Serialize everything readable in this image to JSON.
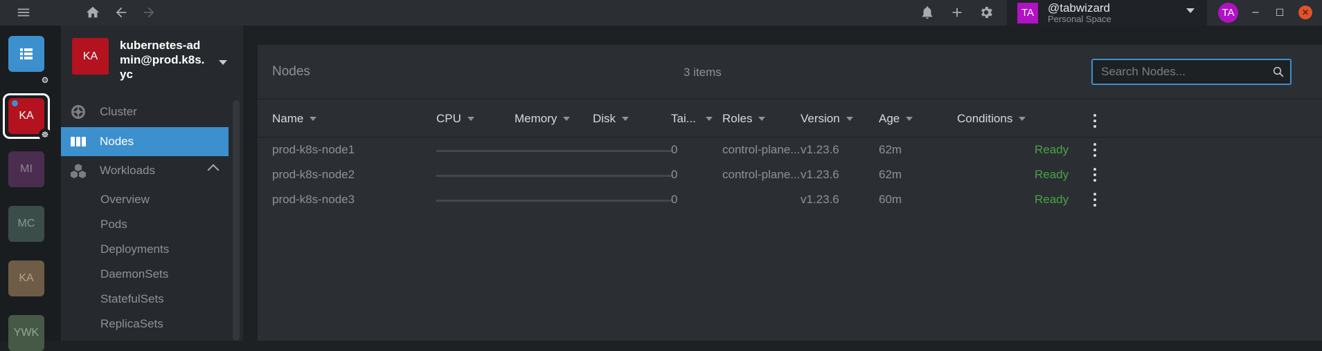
{
  "topbar": {
    "menu_icon": "hamburger-icon",
    "home_icon": "home-icon",
    "back_icon": "arrow-left-icon",
    "forward_icon": "arrow-right-icon",
    "notifications_icon": "bell-icon",
    "add_icon": "plus-icon",
    "settings_icon": "gear-icon",
    "space": {
      "avatar": "TA",
      "name": "@tabwizard",
      "subtitle": "Personal Space"
    },
    "user_avatar": "TA",
    "window": {
      "minimize": "–",
      "maximize": "☐",
      "close": "✕"
    }
  },
  "hotbar": {
    "items": [
      {
        "label": "",
        "kind": "catalog"
      },
      {
        "label": "KA",
        "color": "#b3121e",
        "active": true
      },
      {
        "label": "MI",
        "color": "#4a2d4f"
      },
      {
        "label": "MC",
        "color": "#3b4d48"
      },
      {
        "label": "KA",
        "color": "#6e5c47"
      },
      {
        "label": "YWK",
        "color": "#465946"
      }
    ]
  },
  "sidebar": {
    "cluster": {
      "avatar": "KA",
      "name": "kubernetes-admin@prod.k8s.yc"
    },
    "nav": [
      {
        "label": "Cluster",
        "icon": "helm-icon"
      },
      {
        "label": "Nodes",
        "icon": "nodes-icon",
        "active": true
      },
      {
        "label": "Workloads",
        "icon": "cubes-icon",
        "expanded": true
      }
    ],
    "workloads_sub": [
      "Overview",
      "Pods",
      "Deployments",
      "DaemonSets",
      "StatefulSets",
      "ReplicaSets"
    ]
  },
  "main": {
    "title": "Nodes",
    "count": "3 items",
    "search_placeholder": "Search Nodes...",
    "columns": [
      "Name",
      "CPU",
      "Memory",
      "Disk",
      "Tai...",
      "Roles",
      "Version",
      "Age",
      "Conditions"
    ],
    "rows": [
      {
        "name": "prod-k8s-node1",
        "taints": "0",
        "roles": "control-plane...",
        "version": "v1.23.6",
        "age": "62m",
        "conditions": "Ready"
      },
      {
        "name": "prod-k8s-node2",
        "taints": "0",
        "roles": "control-plane...",
        "version": "v1.23.6",
        "age": "62m",
        "conditions": "Ready"
      },
      {
        "name": "prod-k8s-node3",
        "taints": "0",
        "roles": "",
        "version": "v1.23.6",
        "age": "60m",
        "conditions": "Ready"
      }
    ]
  },
  "colors": {
    "accent": "#3d90ce",
    "ready": "#48a447",
    "cluster": "#b3121e",
    "space": "#b012c4"
  }
}
